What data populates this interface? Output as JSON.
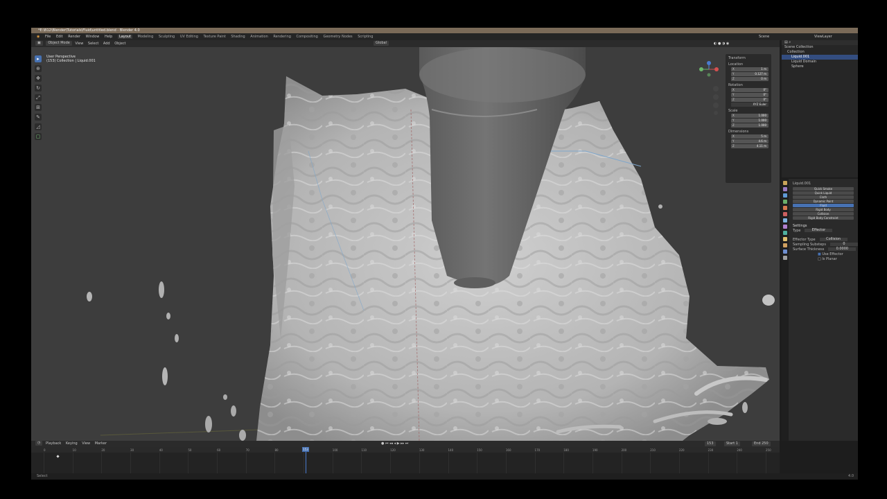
{
  "window": {
    "title": "*E:\\B12\\Blender\\Tutorials\\Fluid\\untitled.blend - Blender 4.0"
  },
  "menu": {
    "items": [
      "File",
      "Edit",
      "Render",
      "Window",
      "Help"
    ],
    "workspaces": [
      "Layout",
      "Modeling",
      "Sculpting",
      "UV Editing",
      "Texture Paint",
      "Shading",
      "Animation",
      "Rendering",
      "Compositing",
      "Geometry Nodes",
      "Scripting"
    ],
    "active_workspace": "Layout",
    "scene": "Scene",
    "view_layer": "ViewLayer"
  },
  "viewport": {
    "header": {
      "mode": "Object Mode",
      "menus": [
        "View",
        "Select",
        "Add",
        "Object"
      ],
      "orientation": "Global"
    },
    "info_line1": "User Perspective",
    "info_line2": "(153) Collection | Liquid.001",
    "tools": [
      "select",
      "cursor",
      "move",
      "rotate",
      "scale",
      "transform",
      "annotate",
      "measure",
      "add-cube"
    ]
  },
  "npanel": {
    "title": "Transform",
    "location_label": "Location",
    "location": [
      "1 m",
      "0.127 m",
      "0 m"
    ],
    "rotation_label": "Rotation",
    "rotation": [
      "0°",
      "0°",
      "0°"
    ],
    "rotation_mode": "XYZ Euler",
    "scale_label": "Scale",
    "scale": [
      "1.000",
      "1.000",
      "1.000"
    ],
    "dimensions_label": "Dimensions",
    "dimensions": [
      "5 m",
      "4.6 m",
      "4.11 m"
    ],
    "axes": [
      "X",
      "Y",
      "Z"
    ]
  },
  "outliner": {
    "items": [
      {
        "label": "Scene Collection",
        "selected": false
      },
      {
        "label": "Collection",
        "selected": false
      },
      {
        "label": "Liquid.001",
        "selected": true
      },
      {
        "label": "Liquid Domain",
        "selected": false
      },
      {
        "label": "Sphere",
        "selected": false
      }
    ]
  },
  "properties": {
    "object_name": "Liquid.001",
    "fields": [
      "Quick Smoke",
      "Quick Liquid",
      "Cloth",
      "Dynamic Paint",
      "Fluid",
      "Rigid Body",
      "Collision",
      "Rigid Body Constraint"
    ],
    "section": "Settings",
    "type_label": "Type",
    "type_value": "Effector",
    "effector_type_label": "Effector Type",
    "effector_type_value": "Collision",
    "subframes_label": "Sampling Substeps",
    "subframes_value": "0",
    "surface_label": "Surface Thickness",
    "surface_value": "0.0000",
    "use_effector_label": "Use Effector",
    "is_planar_label": "Is Planar",
    "tab_colors": [
      "#c9a55a",
      "#9a7cc4",
      "#5f9ad6",
      "#6aae6a",
      "#d67a4f",
      "#cc6060",
      "#7fb2e0",
      "#b07fcf",
      "#4fb0a0",
      "#e0c070",
      "#d0a060",
      "#6f8fcf",
      "#a0a0a0"
    ]
  },
  "timeline": {
    "header_items": [
      "Playback",
      "Keying",
      "View",
      "Marker"
    ],
    "current_frame": "153",
    "start": "Start 1",
    "end": "End 250",
    "ticks": [
      "0",
      "10",
      "20",
      "30",
      "40",
      "50",
      "60",
      "70",
      "80",
      "90",
      "100",
      "110",
      "120",
      "130",
      "140",
      "150",
      "160",
      "170",
      "180",
      "190",
      "200",
      "210",
      "220",
      "230",
      "240",
      "250"
    ]
  },
  "status": {
    "left": "Select",
    "right": "4.0"
  },
  "colors": {
    "accent": "#4772b3",
    "viewport_bg": "#3d3d3d",
    "liquid": "#b9b9b9",
    "title_bar": "#7a6a58"
  }
}
